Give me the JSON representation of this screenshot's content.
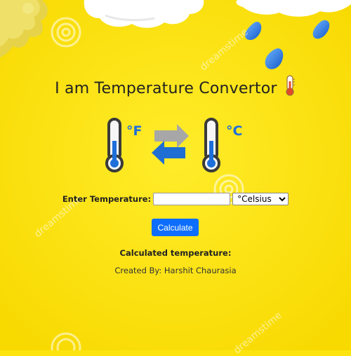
{
  "header": {
    "title": "I am Temperature Convertor"
  },
  "hero": {
    "left_unit": "°F",
    "right_unit": "°C"
  },
  "form": {
    "label": "Enter Temperature:",
    "input_value": "",
    "input_placeholder": "",
    "selected_unit": "°Celsius"
  },
  "actions": {
    "calculate_label": "Calculate"
  },
  "result": {
    "label": "Calculated temperature:"
  },
  "footer": {
    "credit": "Created By: Harshit Chaurasia"
  },
  "watermark": {
    "text": "dreamstime"
  },
  "colors": {
    "background": "#fde40f",
    "button": "#0d6efd",
    "thermometer_blue": "#1e6fd9",
    "arrow_gray": "#a7a7a7",
    "arrow_blue": "#1f6ed4"
  },
  "icons": {
    "title_icon": "thermometer-icon",
    "hero_left": "thermometer-icon",
    "hero_arrows": "swap-arrows-icon",
    "hero_right": "thermometer-icon"
  }
}
